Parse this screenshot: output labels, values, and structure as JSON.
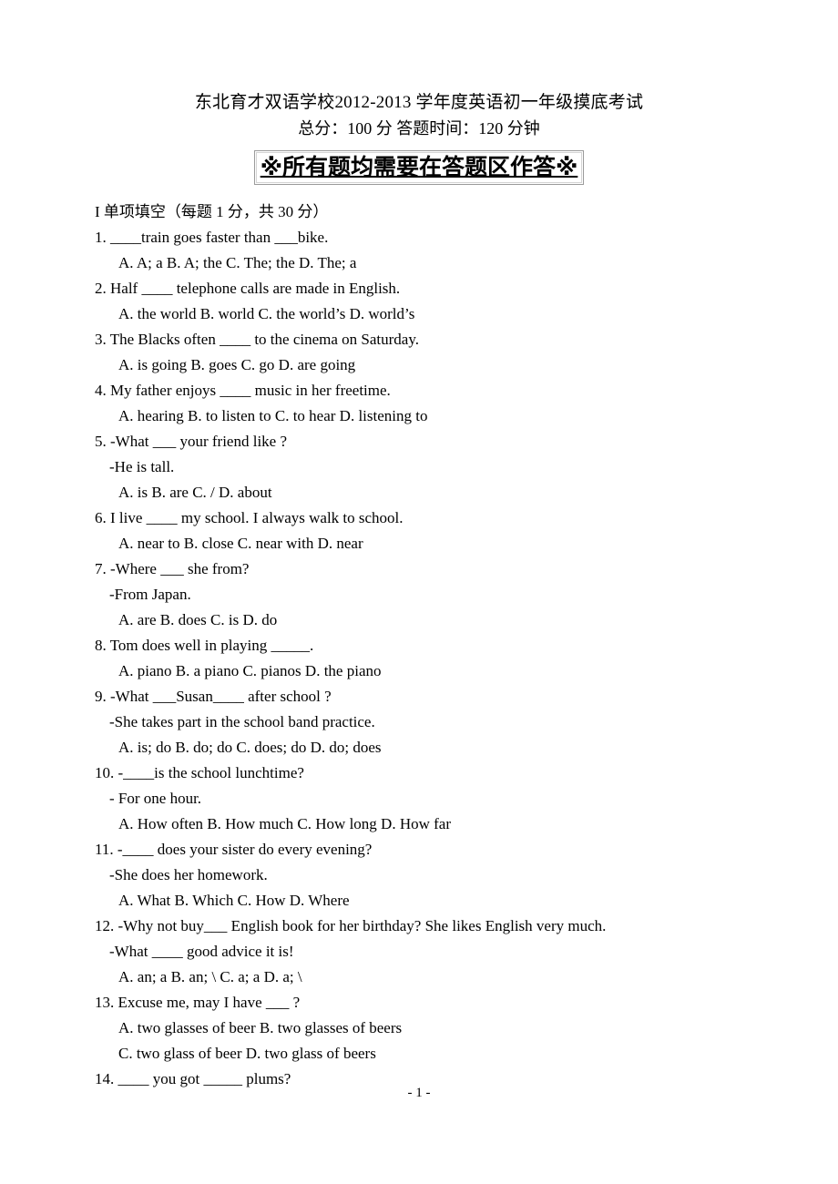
{
  "header": {
    "title": "东北育才双语学校2012-2013 学年度英语初一年级摸底考试",
    "subtitle": "总分：100 分  答题时间：120 分钟",
    "notice": "※所有题均需要在答题区作答※"
  },
  "section": {
    "heading": "I 单项填空（每题 1 分，共 30 分）"
  },
  "questions": [
    {
      "stem": "1.    ____train goes faster than ___bike.",
      "options": "A. A; a        B. A; the        C. The; the        D. The; a"
    },
    {
      "stem": "2. Half ____ telephone calls are made in English.",
      "options": "A. the world   B. world   C. the world’s D. world’s"
    },
    {
      "stem": "3. The Blacks often ____ to the cinema on Saturday.",
      "options": "A. is going   B. goes   C. go   D. are going"
    },
    {
      "stem": "4. My father enjoys ____ music in her freetime.",
      "options": "A. hearing   B. to listen to C. to hear D. listening to"
    },
    {
      "stem": "5. -What ___ your friend like ?",
      "reply": "-He is tall.",
      "options": "A. is   B. are   C. /   D. about"
    },
    {
      "stem": "6. I live ____ my school. I always walk to school.",
      "options": "A. near to B. close   C. near with D. near"
    },
    {
      "stem": "7. -Where ___ she from?",
      "reply": "-From Japan.",
      "options": "A. are    B. does   C. is    D. do"
    },
    {
      "stem": "8. Tom does well in playing _____.",
      "options": "A. piano B. a piano C. pianos D. the piano"
    },
    {
      "stem": "9. -What ___Susan____ after school ?",
      "reply": "-She takes part in the school band practice.",
      "options": "A. is; do B. do; do C. does; do D. do; does"
    },
    {
      "stem": "10. -____is the school lunchtime?",
      "reply": "- For one hour.",
      "options": "A. How often   B. How much C. How long D. How far"
    },
    {
      "stem": "11. -____ does your sister do every evening?",
      "reply": "-She does her homework.",
      "options": "A. What   B. Which C. How D. Where"
    },
    {
      "stem": "12. -Why not buy___ English book for her birthday? She likes English very much.",
      "reply": "-What ____ good advice it is!",
      "options": "A. an; a   B. an; \\   C. a; a   D. a; \\"
    },
    {
      "stem": "13. Excuse me, may I have ___ ?",
      "options": "A. two glasses of beer     B. two glasses of beers",
      "options2": "C. two glass of beer       D. two glass of beers"
    },
    {
      "stem": "14. ____ you got _____ plums?"
    }
  ],
  "footer": {
    "page_number": "- 1 -"
  }
}
